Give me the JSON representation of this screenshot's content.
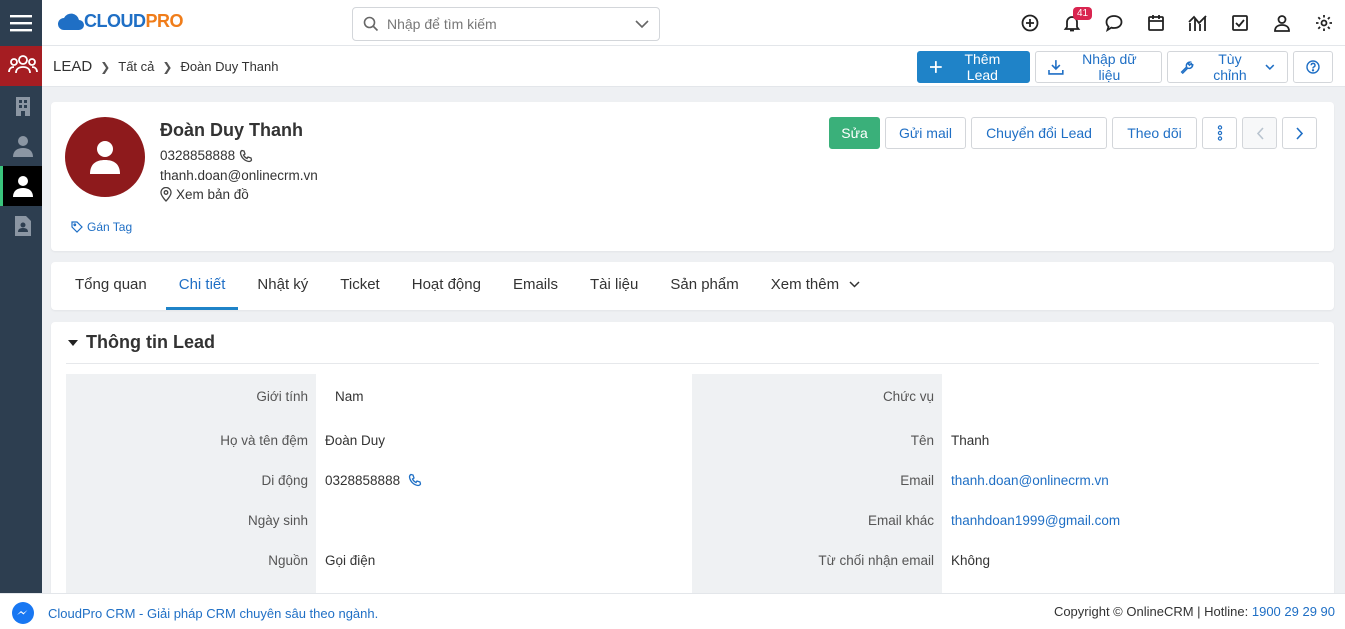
{
  "app": {
    "logo_main": "CLOUD",
    "logo_accent": "PRO"
  },
  "search": {
    "placeholder": "Nhập để tìm kiếm"
  },
  "topbar": {
    "notification_count": "41"
  },
  "breadcrumb": {
    "root": "LEAD",
    "level1": "Tất cả",
    "current": "Đoàn Duy Thanh"
  },
  "toolbar": {
    "add_lead": "Thêm Lead",
    "import": "Nhập dữ liệu",
    "customize": "Tùy chỉnh"
  },
  "profile": {
    "name": "Đoàn Duy Thanh",
    "phone": "0328858888",
    "email": "thanh.doan@onlinecrm.vn",
    "map": "Xem bản đồ",
    "tag": "Gán Tag"
  },
  "profile_actions": {
    "edit": "Sửa",
    "send_mail": "Gửi mail",
    "convert": "Chuyển đổi Lead",
    "follow": "Theo dõi"
  },
  "tabs": [
    {
      "label": "Tổng quan"
    },
    {
      "label": "Chi tiết"
    },
    {
      "label": "Nhật ký"
    },
    {
      "label": "Ticket"
    },
    {
      "label": "Hoạt động"
    },
    {
      "label": "Emails"
    },
    {
      "label": "Tài liệu"
    },
    {
      "label": "Sản phẩm"
    },
    {
      "label": "Xem thêm"
    }
  ],
  "section": {
    "title": "Thông tin Lead"
  },
  "fields_left": [
    {
      "label": "Giới tính",
      "value": "Nam"
    },
    {
      "label": "Họ và tên đệm",
      "value": "Đoàn Duy"
    },
    {
      "label": "Di động",
      "value": "0328858888"
    },
    {
      "label": "Ngày sinh",
      "value": ""
    },
    {
      "label": "Nguồn",
      "value": "Gọi điện"
    }
  ],
  "fields_right": [
    {
      "label": "Chức vụ",
      "value": ""
    },
    {
      "label": "Tên",
      "value": "Thanh"
    },
    {
      "label": "Email",
      "value": "thanh.doan@onlinecrm.vn"
    },
    {
      "label": "Email khác",
      "value": "thanhdoan1999@gmail.com"
    },
    {
      "label": "Từ chối nhận email",
      "value": "Không"
    }
  ],
  "footer": {
    "tagline": "CloudPro CRM - Giải pháp CRM chuyên sâu theo ngành.",
    "copyright": "Copyright © OnlineCRM | Hotline: ",
    "hotline": "1900 29 29 90"
  },
  "colors": {
    "primary": "#1f83c8",
    "success": "#3ab07a",
    "sidebar": "#2d3e50",
    "brand_red": "#a51d22"
  }
}
